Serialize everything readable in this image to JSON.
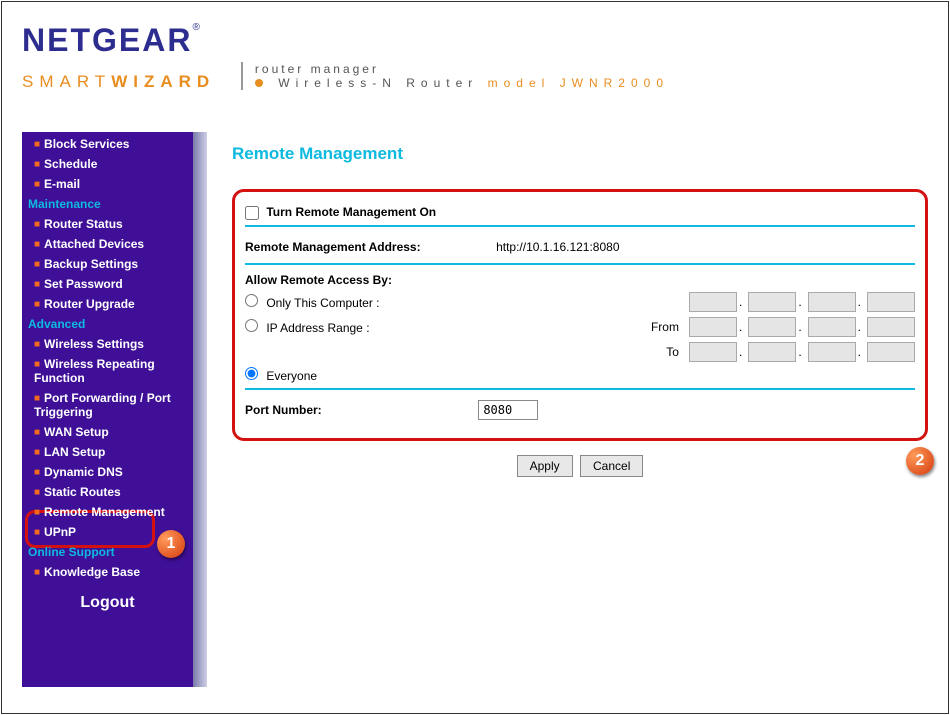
{
  "header": {
    "brand": "NETGEAR",
    "sub1": "SMART",
    "sub2": "WIZARD",
    "product_label": "router manager",
    "product_line": "Wireless-N Router",
    "model_label": "model JWNR2000"
  },
  "sidebar": {
    "items": [
      {
        "label": "Block Services"
      },
      {
        "label": "Schedule"
      },
      {
        "label": "E-mail"
      }
    ],
    "cat_maintenance": "Maintenance",
    "maintenance_items": [
      {
        "label": "Router Status"
      },
      {
        "label": "Attached Devices"
      },
      {
        "label": "Backup Settings"
      },
      {
        "label": "Set Password"
      },
      {
        "label": "Router Upgrade"
      }
    ],
    "cat_advanced": "Advanced",
    "advanced_items": [
      {
        "label": "Wireless Settings"
      },
      {
        "label": "Wireless Repeating Function"
      },
      {
        "label": "Port Forwarding / Port Triggering"
      },
      {
        "label": "WAN Setup"
      },
      {
        "label": "LAN Setup"
      },
      {
        "label": "Dynamic DNS"
      },
      {
        "label": "Static Routes"
      },
      {
        "label": "Remote Management"
      },
      {
        "label": "UPnP"
      }
    ],
    "cat_support": "Online Support",
    "support_items": [
      {
        "label": "Knowledge Base"
      }
    ],
    "logout": "Logout"
  },
  "page": {
    "title": "Remote Management",
    "turn_on_label": "Turn Remote Management On",
    "address_label": "Remote Management Address:",
    "address_value": "http://10.1.16.121:8080",
    "allow_label": "Allow Remote Access By:",
    "only_this": "Only This Computer :",
    "ip_range": "IP Address Range :",
    "from_label": "From",
    "to_label": "To",
    "everyone": "Everyone",
    "port_label": "Port Number:",
    "port_value": "8080",
    "apply": "Apply",
    "cancel": "Cancel"
  },
  "annotations": {
    "badge1": "1",
    "badge2": "2"
  }
}
